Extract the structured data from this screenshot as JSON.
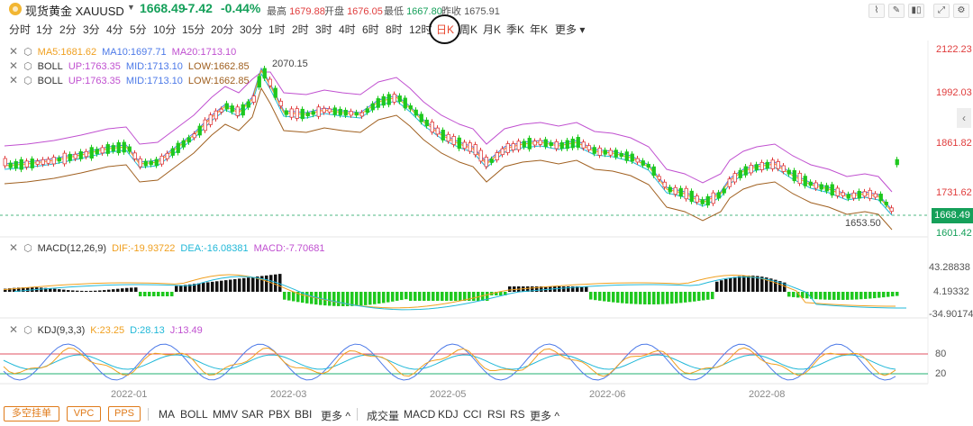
{
  "header": {
    "title": "现货黄金 XAUUSD",
    "price": "1668.49",
    "change": "-7.42",
    "change_pct": "-0.44%",
    "high_label": "最高",
    "high": "1679.88",
    "open_label": "开盘",
    "open": "1676.05",
    "low_label": "最低",
    "low": "1667.80",
    "prev_label": "昨收",
    "prev": "1675.91"
  },
  "periods": [
    "分时",
    "1分",
    "2分",
    "3分",
    "4分",
    "5分",
    "10分",
    "15分",
    "20分",
    "30分",
    "1时",
    "2时",
    "3时",
    "4时",
    "6时",
    "8时",
    "12时",
    "日K",
    "周K",
    "月K",
    "季K",
    "年K",
    "更多"
  ],
  "active_period": "日K",
  "legends": {
    "ma": {
      "ma5": "MA5:1681.62",
      "ma10": "MA10:1697.71",
      "ma20": "MA20:1713.10"
    },
    "boll1": {
      "name": "BOLL",
      "up": "UP:1763.35",
      "mid": "MID:1713.10",
      "low": "LOW:1662.85"
    },
    "boll2": {
      "name": "BOLL",
      "up": "UP:1763.35",
      "mid": "MID:1713.10",
      "low": "LOW:1662.85"
    },
    "macd": {
      "name": "MACD(12,26,9)",
      "dif": "DIF:-19.93722",
      "dea": "DEA:-16.08381",
      "macd": "MACD:-7.70681"
    },
    "kdj": {
      "name": "KDJ(9,3,3)",
      "k": "K:23.25",
      "d": "D:28.13",
      "j": "J:13.49"
    }
  },
  "price_axis": [
    "2122.23",
    "1992.03",
    "1861.82",
    "1731.62",
    "1601.42"
  ],
  "current_price_tag": "1668.49",
  "max_label": "2070.15",
  "min_label": "1653.50",
  "macd_axis": [
    "43.28838",
    "4.19332",
    "-34.90174"
  ],
  "kdj_axis": [
    "80",
    "20"
  ],
  "date_axis": [
    "2022-01",
    "2022-03",
    "2022-05",
    "2022-06",
    "2022-08"
  ],
  "bottom": {
    "buttons": [
      "多空挂单",
      "VPC",
      "PPS"
    ],
    "main_inds": [
      "MA",
      "BOLL",
      "MMV",
      "SAR",
      "PBX",
      "BBI",
      "更多 ^"
    ],
    "sub_inds": [
      "成交量",
      "MACD",
      "KDJ",
      "CCI",
      "RSI",
      "RS",
      "更多 ^"
    ]
  },
  "colors": {
    "up": "#e03c3c",
    "down": "#1ec81e",
    "ma5": "#f0a020",
    "ma10": "#21b8d8",
    "ma20": "#4d7ae8",
    "boll_up": "#c050d0",
    "boll_low": "#a06020"
  }
}
